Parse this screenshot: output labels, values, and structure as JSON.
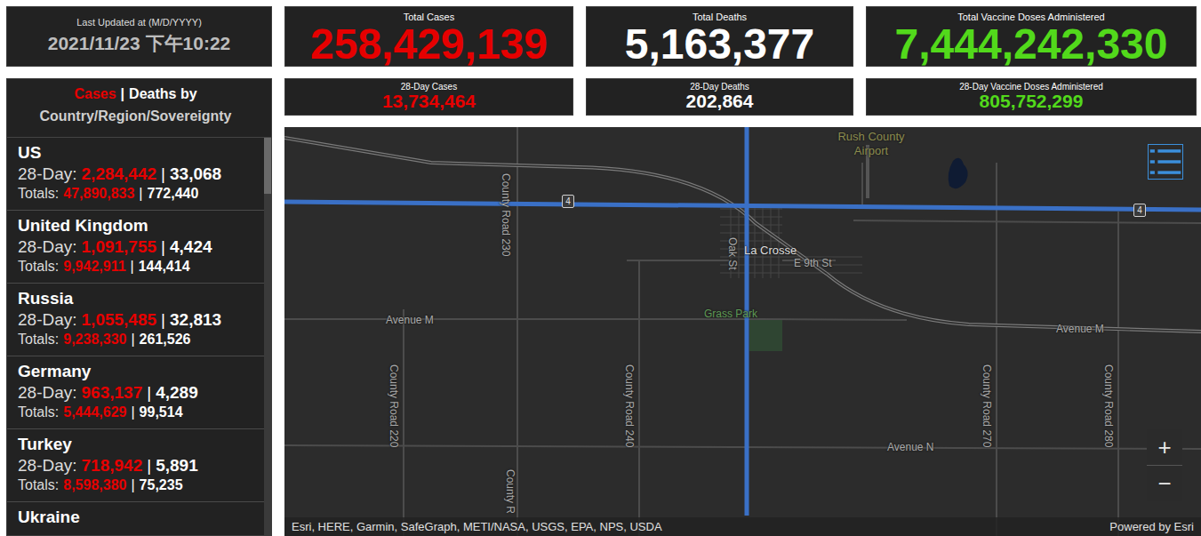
{
  "last_updated": {
    "label": "Last Updated at (M/D/YYYY)",
    "value": "2021/11/23 下午10:22"
  },
  "totals": [
    {
      "label": "Total Cases",
      "value": "258,429,139",
      "color": "#e60000"
    },
    {
      "label": "Total Deaths",
      "value": "5,163,377",
      "color": "#ffffff"
    },
    {
      "label": "Total Vaccine Doses Administered",
      "value": "7,444,242,330",
      "color": "#52d91b"
    }
  ],
  "period_totals": [
    {
      "label": "28-Day Cases",
      "value": "13,734,464",
      "color": "#e60000"
    },
    {
      "label": "28-Day Deaths",
      "value": "202,864",
      "color": "#ffffff"
    },
    {
      "label": "28-Day Vaccine Doses Administered",
      "value": "805,752,299",
      "color": "#52d91b"
    }
  ],
  "sidebar": {
    "title_cases": "Cases",
    "separator": "|",
    "title_deaths": "Deaths by",
    "subtitle": "Country/Region/Sovereignty",
    "scroll": {
      "level": 0.14
    },
    "items": [
      {
        "name": "US",
        "period_label": "28-Day:",
        "period_cases": "2,284,442",
        "period_deaths": "33,068",
        "totals_label": "Totals:",
        "total_cases": "47,890,833",
        "total_deaths": "772,440"
      },
      {
        "name": "United Kingdom",
        "period_label": "28-Day:",
        "period_cases": "1,091,755",
        "period_deaths": "4,424",
        "totals_label": "Totals:",
        "total_cases": "9,942,911",
        "total_deaths": "144,414"
      },
      {
        "name": "Russia",
        "period_label": "28-Day:",
        "period_cases": "1,055,485",
        "period_deaths": "32,813",
        "totals_label": "Totals:",
        "total_cases": "9,238,330",
        "total_deaths": "261,526"
      },
      {
        "name": "Germany",
        "period_label": "28-Day:",
        "period_cases": "963,137",
        "period_deaths": "4,289",
        "totals_label": "Totals:",
        "total_cases": "5,444,629",
        "total_deaths": "99,514"
      },
      {
        "name": "Turkey",
        "period_label": "28-Day:",
        "period_cases": "718,942",
        "period_deaths": "5,891",
        "totals_label": "Totals:",
        "total_cases": "8,598,380",
        "total_deaths": "75,235"
      },
      {
        "name": "Ukraine"
      }
    ]
  },
  "map": {
    "labels": [
      {
        "text": "Rush County Airport",
        "kind": "poi"
      },
      {
        "text": "La Crosse",
        "kind": "place"
      },
      {
        "text": "Oak St",
        "kind": "street-vertical"
      },
      {
        "text": "E 9th St",
        "kind": "street"
      },
      {
        "text": "Grass Park",
        "kind": "park"
      },
      {
        "text": "Avenue M",
        "kind": "street"
      },
      {
        "text": "Avenue M",
        "kind": "street"
      },
      {
        "text": "Avenue N",
        "kind": "street"
      },
      {
        "text": "County Road 230",
        "kind": "street-vertical"
      },
      {
        "text": "County Road 220",
        "kind": "street-vertical"
      },
      {
        "text": "County Road 240",
        "kind": "street-vertical"
      },
      {
        "text": "County Road 270",
        "kind": "street-vertical"
      },
      {
        "text": "County Road 280",
        "kind": "street-vertical"
      },
      {
        "text": "County R",
        "kind": "street-vertical"
      }
    ],
    "shields": [
      "4",
      "4"
    ],
    "zoom_in": "+",
    "zoom_out": "−",
    "attribution": "Esri, HERE, Garmin, SafeGraph, METI/NASA, USGS, EPA, NPS, USDA",
    "powered_by": "Powered by Esri"
  }
}
